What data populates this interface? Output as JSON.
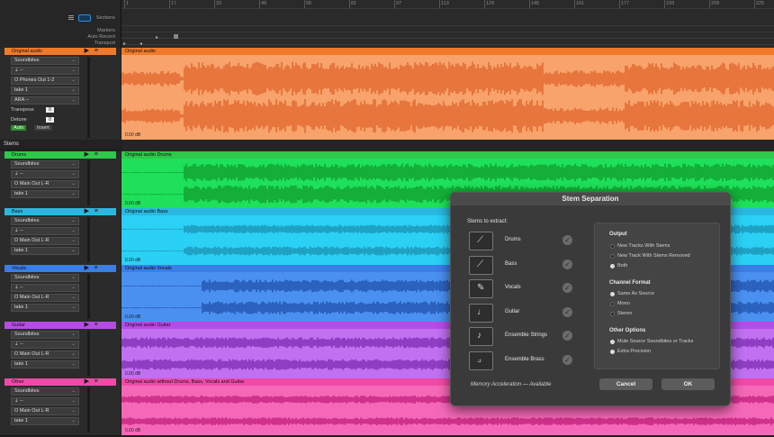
{
  "top": {
    "sections_label": "Sections",
    "markers_label": "Markers",
    "autorecord_label": "Auto Record",
    "transport_label": "Transport"
  },
  "ruler": {
    "ticks": [
      "1",
      "17",
      "33",
      "49",
      "65",
      "81",
      "97",
      "113",
      "129",
      "145",
      "161",
      "177",
      "193",
      "209",
      "225"
    ]
  },
  "main_track": {
    "name": "Original audio",
    "color": "#f07a2a",
    "lane_color": "#f7a36b",
    "wave_color": "#e0622a",
    "instrument": "Soundbites",
    "input": "--",
    "output": "Phones Out 1-2",
    "take": "take 1",
    "ara": "ARA --",
    "transpose_label": "Transpose",
    "transpose_value": "0",
    "detune_label": "Detune",
    "detune_value": "0",
    "auto_label": "Auto",
    "insert_label": "Insert",
    "clip_title": "Original audio",
    "gain": "0.00 dB"
  },
  "stems_label": "Stems",
  "tracks": [
    {
      "name": "Drums",
      "color": "#2ec84a",
      "lane_color": "#1ee05a",
      "wave_color": "#109a2a",
      "instrument": "Soundbites",
      "input": "--",
      "output": "Main Out L-R",
      "take": "take 1",
      "clip_title": "Original audio Drums",
      "gain": "0.00 dB"
    },
    {
      "name": "Bass",
      "color": "#2ab8e0",
      "lane_color": "#2bd0f5",
      "wave_color": "#1a8fb0",
      "instrument": "Soundbites",
      "input": "--",
      "output": "Main Out L-R",
      "take": "take 1",
      "clip_title": "Original audio Bass",
      "gain": "0.00 dB"
    },
    {
      "name": "Vocals",
      "color": "#3a7ee8",
      "lane_color": "#4a90f0",
      "wave_color": "#1e4fa8",
      "instrument": "Soundbites",
      "input": "--",
      "output": "Main Out L-R",
      "take": "take 1",
      "clip_title": "Original audio Vocals",
      "gain": "0.00 dB"
    },
    {
      "name": "Guitar",
      "color": "#b84ae8",
      "lane_color": "#c070f0",
      "wave_color": "#7a2ab0",
      "instrument": "Soundbites",
      "input": "--",
      "output": "Main Out L-R",
      "take": "take 1",
      "clip_title": "Original audio Guitar",
      "gain": "0.00 dB"
    },
    {
      "name": "Other",
      "color": "#f04aa8",
      "lane_color": "#f568b8",
      "wave_color": "#c01a78",
      "instrument": "Soundbites",
      "input": "--",
      "output": "Main Out L-R",
      "take": "take 1",
      "clip_title": "Original audio without Drums, Bass, Vocals and Guitar",
      "gain": "0.00 dB"
    }
  ],
  "dialog": {
    "title": "Stem Separation",
    "stems_heading": "Stems to extract:",
    "stems": [
      {
        "label": "Drums",
        "icon": "drumsticks-icon",
        "checked": true
      },
      {
        "label": "Bass",
        "icon": "bass-guitar-icon",
        "checked": true
      },
      {
        "label": "Vocals",
        "icon": "microphone-icon",
        "checked": true
      },
      {
        "label": "Guitar",
        "icon": "guitar-icon",
        "checked": true
      },
      {
        "label": "Ensemble Strings",
        "icon": "violin-icon",
        "checked": true
      },
      {
        "label": "Ensemble Brass",
        "icon": "trumpet-icon",
        "checked": true
      }
    ],
    "output_heading": "Output",
    "output_options": [
      {
        "label": "New Tracks With Stems",
        "selected": false
      },
      {
        "label": "New Track With Stems Removed",
        "selected": false
      },
      {
        "label": "Both",
        "selected": true
      }
    ],
    "channel_heading": "Channel Format",
    "channel_options": [
      {
        "label": "Same As Source",
        "selected": true
      },
      {
        "label": "Mono",
        "selected": false
      },
      {
        "label": "Stereo",
        "selected": false
      }
    ],
    "other_heading": "Other Options",
    "other_options": [
      {
        "label": "Mute Source Soundbites or Tracks",
        "selected": true
      },
      {
        "label": "Extra Precision",
        "selected": true
      }
    ],
    "memory_text": "Memory Acceleration — Available",
    "cancel_label": "Cancel",
    "ok_label": "OK"
  }
}
